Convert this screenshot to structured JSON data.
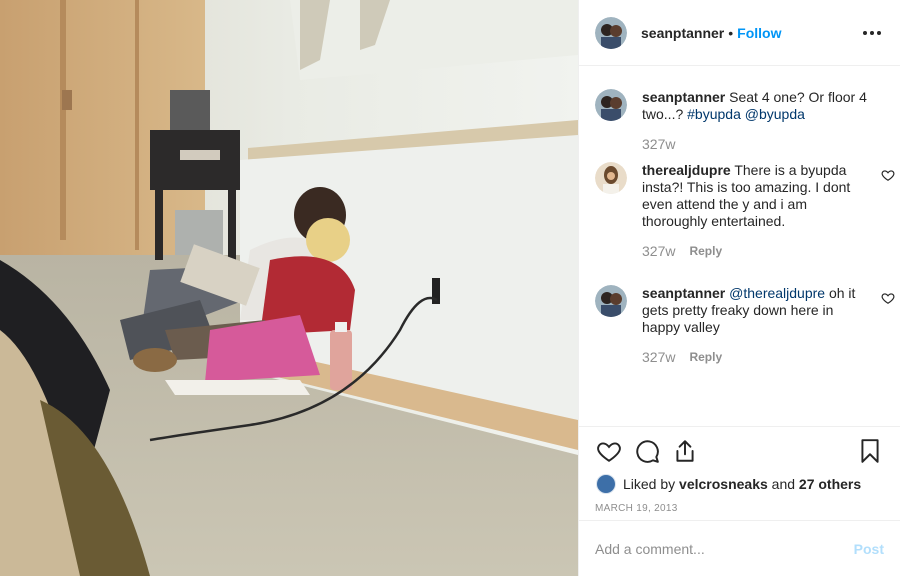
{
  "header": {
    "username": "seanptanner",
    "separator": "•",
    "follow_label": "Follow",
    "more_icon": "more-horizontal-icon"
  },
  "comments": [
    {
      "username": "seanptanner",
      "text": "Seat 4 one? Or floor 4 two...?",
      "tags": "#byupda @byupda",
      "time": "327w",
      "is_caption": true
    },
    {
      "username": "therealjdupre",
      "text": "There is a byupda insta?! This is too amazing. I dont even attend the y and i am thoroughly entertained.",
      "time": "327w",
      "reply_label": "Reply"
    },
    {
      "username": "seanptanner",
      "mention": "@therealjdupre",
      "text": "oh it gets pretty freaky down here in happy valley",
      "time": "327w",
      "reply_label": "Reply"
    }
  ],
  "actions": {
    "icons": [
      "heart-icon",
      "comment-icon",
      "share-icon",
      "bookmark-icon"
    ]
  },
  "likes": {
    "prefix": "Liked by",
    "user": "velcrosneaks",
    "connector": "and",
    "others": "27 others"
  },
  "date": "March 19, 2013",
  "add_comment": {
    "placeholder": "Add a comment...",
    "post_label": "Post"
  },
  "colors": {
    "link_blue": "#0095f6",
    "hashtag_blue": "#00376b",
    "muted": "#8e8e8e",
    "post_disabled": "#b2dffc"
  }
}
